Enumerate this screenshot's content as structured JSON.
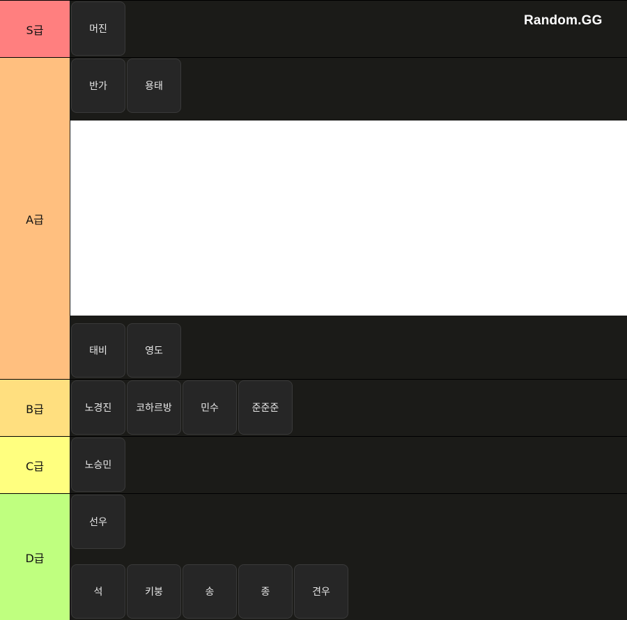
{
  "brand": "Random.GG",
  "tiers": [
    {
      "label": "S급",
      "color": "#ff7f7f",
      "items": [
        "머진"
      ]
    },
    {
      "label": "A급",
      "color": "#ffbf7f",
      "items": [
        "반가",
        "용태",
        "태비",
        "영도"
      ]
    },
    {
      "label": "B급",
      "color": "#ffdf7f",
      "items": [
        "노경진",
        "코하르방",
        "민수",
        "준준준"
      ]
    },
    {
      "label": "C급",
      "color": "#ffff7f",
      "items": [
        "노승민"
      ]
    },
    {
      "label": "D급",
      "color": "#bfff7f",
      "items": [
        "선우",
        "석",
        "키붕",
        "송",
        "종",
        "견우"
      ]
    }
  ]
}
